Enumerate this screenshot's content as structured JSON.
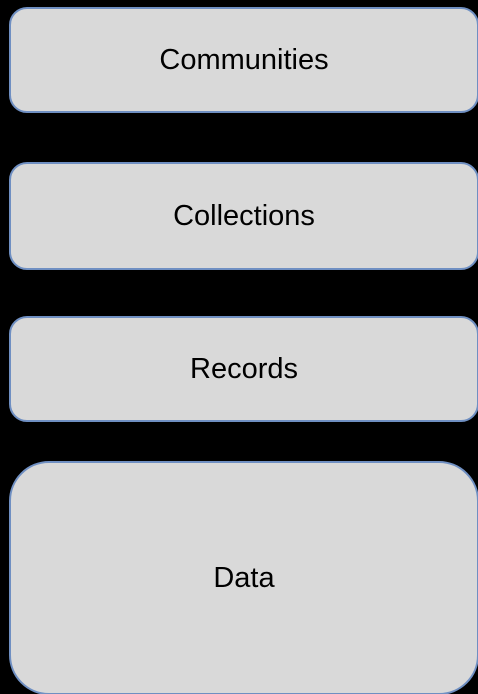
{
  "diagram": {
    "boxes": [
      {
        "label": "Communities"
      },
      {
        "label": "Collections"
      },
      {
        "label": "Records"
      },
      {
        "label": "Data"
      }
    ]
  },
  "colors": {
    "background": "#000000",
    "box_fill": "#d9d9d9",
    "box_border": "#6f8fc2",
    "text": "#000000"
  }
}
